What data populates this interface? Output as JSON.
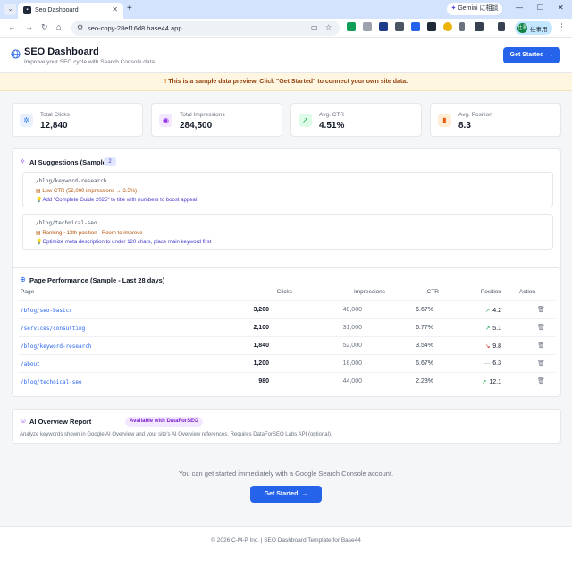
{
  "browser": {
    "tab_title": "Seo Dashboard",
    "new_tab": "+",
    "gemini_label": "Gemini に相談",
    "url": "seo-copy-28ef16d8.base44.app",
    "profile_name": "仕事用",
    "profile_initials": "仕事"
  },
  "header": {
    "title": "SEO Dashboard",
    "subtitle": "Improve your SEO cycle with Search Console data",
    "cta_label": "Get Started"
  },
  "banner": {
    "text": "This is a sample data preview. Click \"Get Started\" to connect your own site data."
  },
  "stats": [
    {
      "label": "Total Clicks",
      "value": "12,840",
      "icon": "cursor-click-icon",
      "color": "#3b82f6",
      "bg": "#e8f0fe"
    },
    {
      "label": "Total Impressions",
      "value": "284,500",
      "icon": "eye-icon",
      "color": "#9333ea",
      "bg": "#f3e8ff"
    },
    {
      "label": "Avg. CTR",
      "value": "4.51%",
      "icon": "trending-up-icon",
      "color": "#16a34a",
      "bg": "#dcfce7"
    },
    {
      "label": "Avg. Position",
      "value": "8.3",
      "icon": "bar-chart-icon",
      "color": "#ea580c",
      "bg": "#ffedd5"
    }
  ],
  "suggestions": {
    "title": "AI Suggestions (Sample)",
    "count": "2",
    "items": [
      {
        "url": "/blog/keyword-research",
        "issue": "Low CTR (52,000 impressions → 3.5%)",
        "fix": "Add \"Complete Guide 2025\" to title with numbers to boost appeal"
      },
      {
        "url": "/blog/technical-seo",
        "issue": "Ranking ~12th position - Room to improve",
        "fix": "Optimize meta description to under 120 chars, place main keyword first"
      }
    ]
  },
  "performance": {
    "title": "Page Performance (Sample - Last 28 days)",
    "columns": [
      "Page",
      "Clicks",
      "Impressions",
      "CTR",
      "Position",
      "Action"
    ],
    "rows": [
      {
        "page": "/blog/seo-basics",
        "clicks": "3,200",
        "impressions": "48,000",
        "ctr": "6.67%",
        "position": "4.2",
        "trend": "↗",
        "trend_color": "#16a34a"
      },
      {
        "page": "/services/consulting",
        "clicks": "2,100",
        "impressions": "31,000",
        "ctr": "6.77%",
        "position": "5.1",
        "trend": "↗",
        "trend_color": "#16a34a"
      },
      {
        "page": "/blog/keyword-research",
        "clicks": "1,840",
        "impressions": "52,000",
        "ctr": "3.54%",
        "position": "9.8",
        "trend": "↘",
        "trend_color": "#dc2626"
      },
      {
        "page": "/about",
        "clicks": "1,200",
        "impressions": "18,000",
        "ctr": "6.67%",
        "position": "6.3",
        "trend": "—",
        "trend_color": "#9ca3af"
      },
      {
        "page": "/blog/technical-seo",
        "clicks": "980",
        "impressions": "44,000",
        "ctr": "2.23%",
        "position": "12.1",
        "trend": "↗",
        "trend_color": "#16a34a"
      }
    ]
  },
  "overview": {
    "title": "AI Overview Report",
    "pill": "Available with DataForSEO",
    "desc": "Analyze keywords shown in Google AI Overview and your site's AI Overview references. Requires DataForSEO Labs API (optional)."
  },
  "cta": {
    "text": "You can get started immediately with a Google Search Console account.",
    "button": "Get Started"
  },
  "footer": {
    "text": "© 2026 C-M-P Inc. | SEO Dashboard Template for Base44"
  }
}
